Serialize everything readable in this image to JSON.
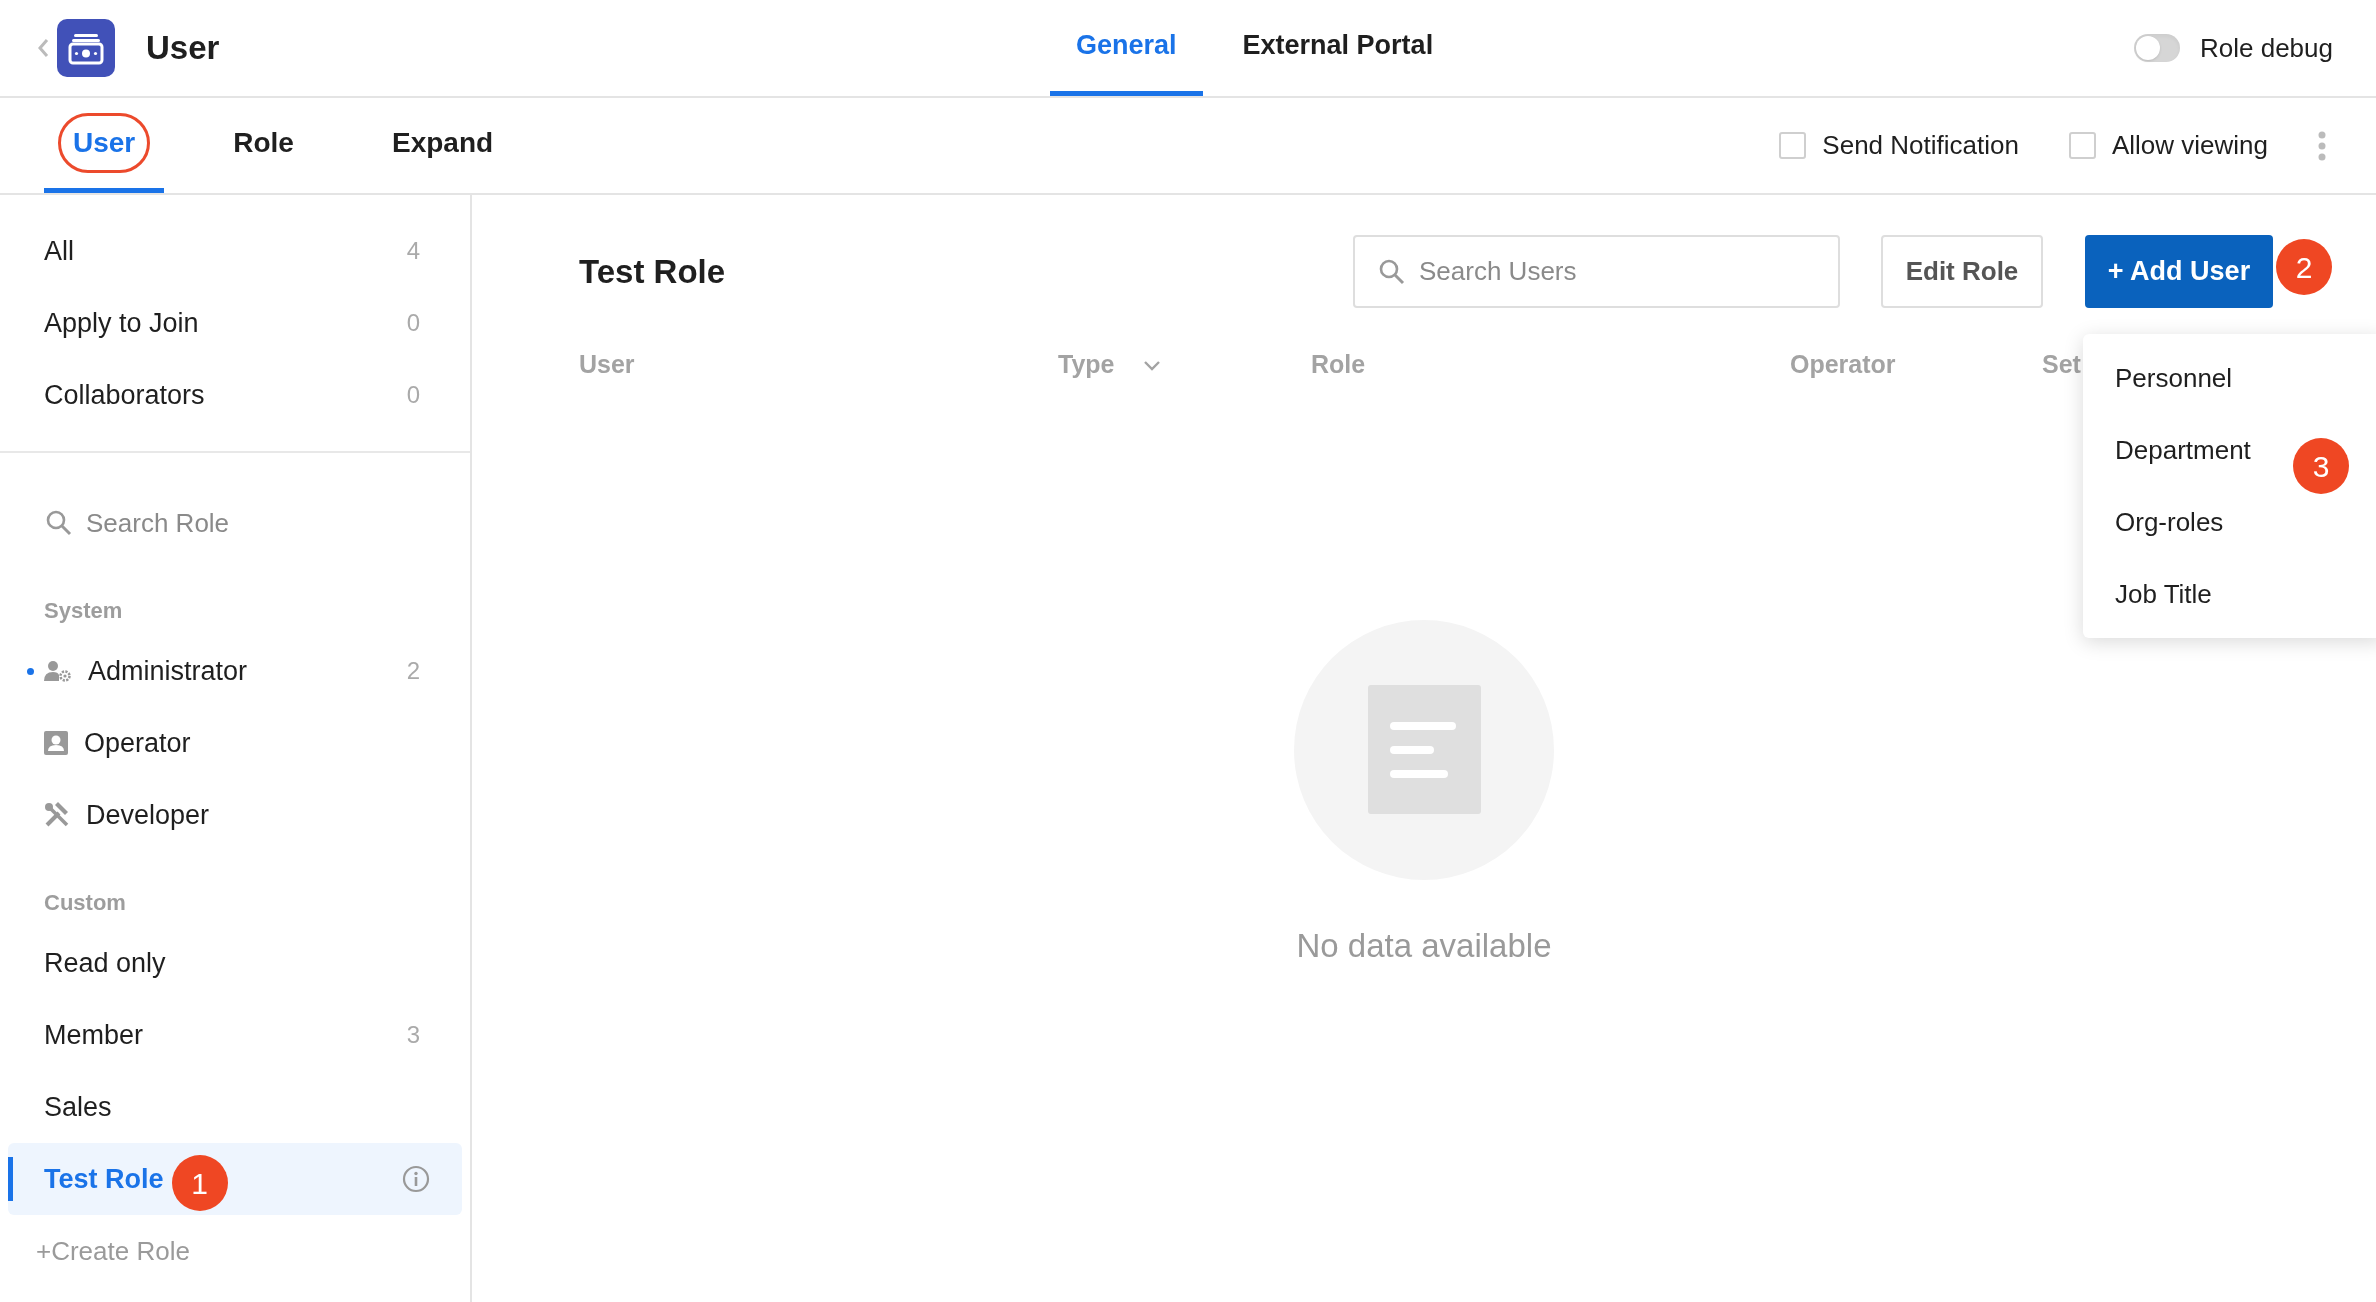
{
  "header": {
    "title": "User",
    "tabs": [
      {
        "label": "General",
        "selected": true
      },
      {
        "label": "External Portal",
        "selected": false
      }
    ],
    "role_debug": {
      "label": "Role debug",
      "on": false
    }
  },
  "subtabs": [
    {
      "label": "User",
      "selected": true,
      "circled": true
    },
    {
      "label": "Role",
      "selected": false,
      "circled": false
    },
    {
      "label": "Expand",
      "selected": false,
      "circled": false
    }
  ],
  "options": [
    {
      "label": "Send Notification",
      "checked": false
    },
    {
      "label": "Allow viewing",
      "checked": false
    }
  ],
  "sidebar": {
    "filters": [
      {
        "label": "All",
        "count": "4"
      },
      {
        "label": "Apply to Join",
        "count": "0"
      },
      {
        "label": "Collaborators",
        "count": "0"
      }
    ],
    "search": {
      "placeholder": "Search Role"
    },
    "groups": [
      {
        "title": "System",
        "roles": [
          {
            "label": "Administrator",
            "kind": "admin",
            "count": "2",
            "dot": true,
            "selected": false
          },
          {
            "label": "Operator",
            "kind": "operator",
            "dot": false,
            "selected": false
          },
          {
            "label": "Developer",
            "kind": "developer",
            "dot": false,
            "selected": false
          }
        ]
      },
      {
        "title": "Custom",
        "roles": [
          {
            "label": "Read only",
            "dot": false,
            "selected": false
          },
          {
            "label": "Member",
            "count": "3",
            "dot": false,
            "selected": false
          },
          {
            "label": "Sales",
            "dot": false,
            "selected": false
          },
          {
            "label": "Test Role",
            "dot": false,
            "selected": true,
            "badge": "1",
            "info": true
          }
        ]
      }
    ],
    "create": "+Create Role"
  },
  "main": {
    "title": "Test Role",
    "search": {
      "placeholder": "Search Users"
    },
    "edit_button": "Edit Role",
    "add_button": {
      "label": "+ Add User",
      "badge": "2"
    },
    "columns": [
      {
        "label": "User",
        "menu": false
      },
      {
        "label": "Type",
        "menu": true
      },
      {
        "label": "Role",
        "menu": false
      },
      {
        "label": "Operator",
        "menu": false
      },
      {
        "label": "Set",
        "menu": false
      }
    ],
    "empty": "No data available",
    "add_menu": [
      {
        "label": "Personnel"
      },
      {
        "label": "Department",
        "badge": "3"
      },
      {
        "label": "Org-roles"
      },
      {
        "label": "Job Title"
      }
    ]
  }
}
